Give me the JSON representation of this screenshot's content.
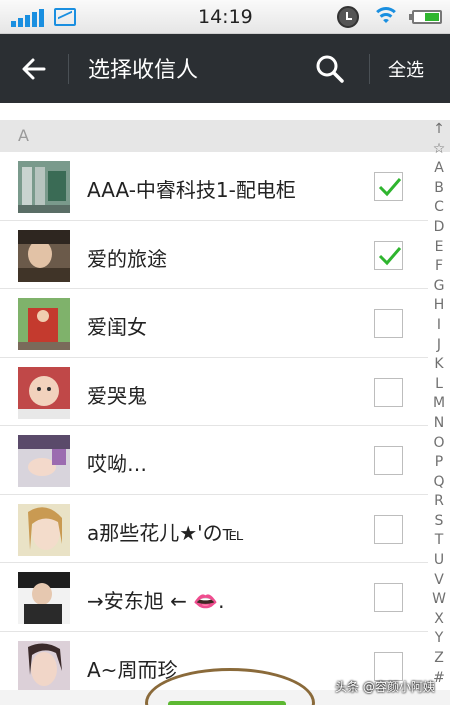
{
  "status_bar": {
    "time": "14:19",
    "icons": [
      "signal-icon",
      "image-icon",
      "alarm-icon",
      "wifi-icon",
      "battery-icon"
    ]
  },
  "header": {
    "title": "选择收信人",
    "select_all_label": "全选",
    "icons": {
      "back": "back-arrow-icon",
      "search": "search-icon"
    }
  },
  "section": {
    "letter": "A"
  },
  "contacts": [
    {
      "name": "AAA-中睿科技1-配电柜",
      "checked": true
    },
    {
      "name": "爱的旅途",
      "checked": true
    },
    {
      "name": "爱闺女",
      "checked": false
    },
    {
      "name": "爱哭鬼",
      "checked": false
    },
    {
      "name": "哎呦…",
      "checked": false
    },
    {
      "name": "a那些花儿★'の℡",
      "checked": false
    },
    {
      "name": "→安东旭 ← 👄.",
      "checked": false
    },
    {
      "name": "A~周而珍",
      "checked": false
    }
  ],
  "index_letters": [
    "↑",
    "☆",
    "A",
    "B",
    "C",
    "D",
    "E",
    "F",
    "G",
    "H",
    "I",
    "J",
    "K",
    "L",
    "M",
    "N",
    "O",
    "P",
    "Q",
    "R",
    "S",
    "T",
    "U",
    "V",
    "W",
    "X",
    "Y",
    "Z",
    "#"
  ],
  "watermark": "头条 @容颜小阿姨",
  "colors": {
    "header_bg": "#2b2f33",
    "accent_green": "#2fb52f",
    "button_green": "#5cb832"
  }
}
